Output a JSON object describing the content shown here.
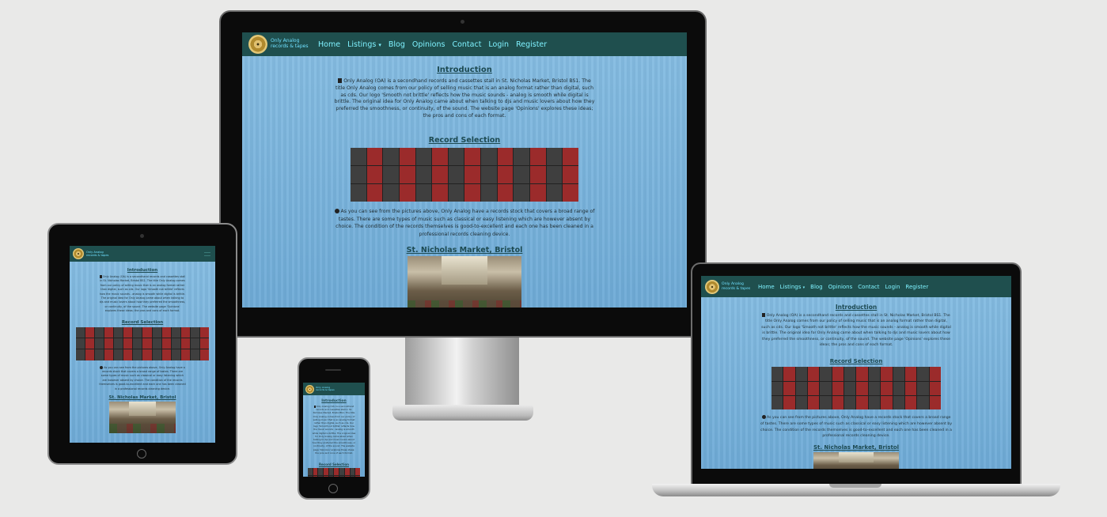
{
  "site": {
    "logo_line1": "Only Analog",
    "logo_line2": "records & tapes",
    "nav": [
      "Home",
      "Listings",
      "Blog",
      "Opinions",
      "Contact",
      "Login",
      "Register"
    ],
    "listings_caret": "▾",
    "intro_title": "Introduction",
    "intro_text": "Only Analog (OA) is a secondhand records and cassettes stall in St. Nicholas Market, Bristol BS1. The title Only Analog comes from our policy of selling music that is an analog format rather than digital, such as cds. Our logo 'Smooth not brittle' reflects how the music sounds - analog is smooth while digital is brittle. The original idea for Only Analog came about when talking to djs and music lovers about how they preferred the smoothness, or continuity, of the sound. The website page 'Opinions' explores these ideas; the pros and cons of each format.",
    "records_title": "Record Selection",
    "records_text": "As you can see from the pictures above, Only Analog have a records stock that covers a broad range of tastes. There are some types of music such as classical or easy listening which are however absent by choice. The condition of the records themselves is good-to-excellent and each one has been cleaned in a professional records cleaning device.",
    "market_title": "St. Nicholas Market, Bristol"
  },
  "colors": {
    "nav_bg": "#1f4f4e",
    "nav_link": "#7ff2ff",
    "page_bg": "#7fb6dc",
    "heading": "#1d4a52"
  },
  "icons": {
    "intro": "document-icon",
    "records": "info-circle-icon",
    "menu": "hamburger-menu-icon"
  }
}
